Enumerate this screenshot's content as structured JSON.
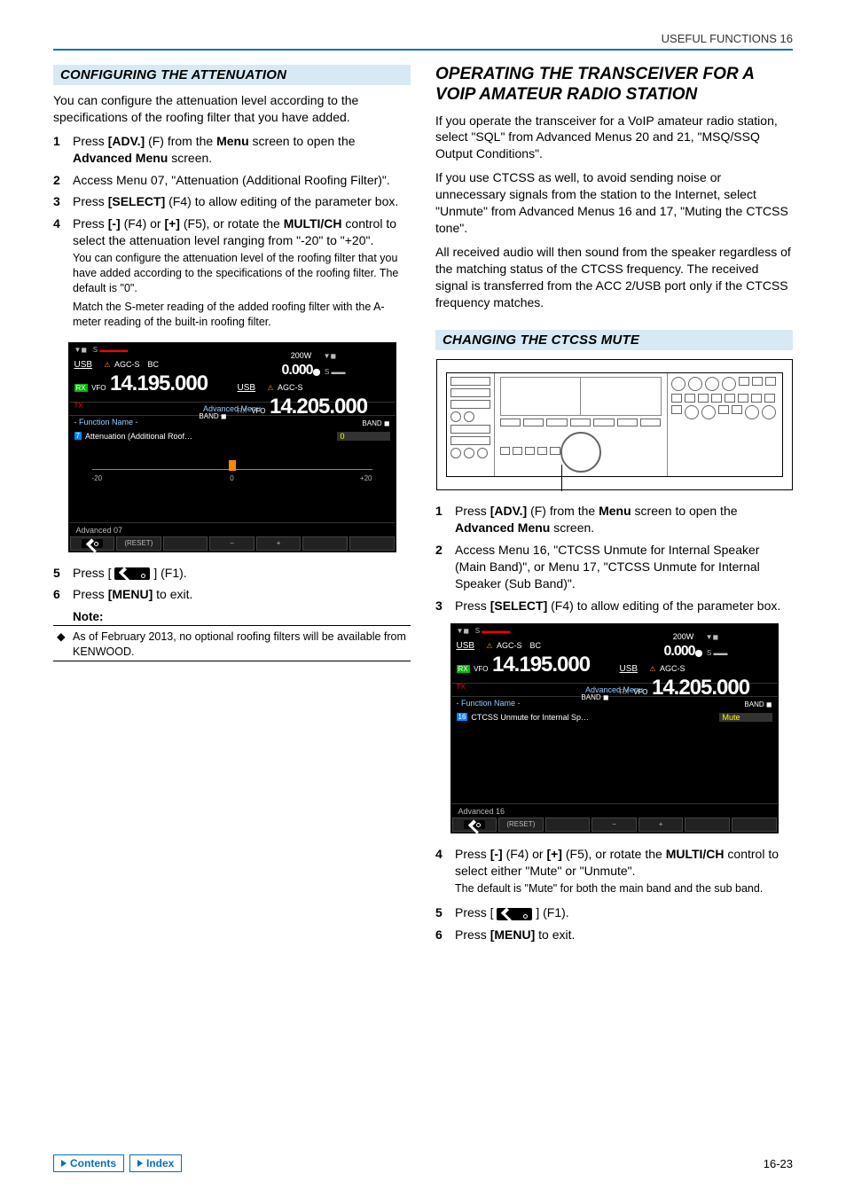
{
  "page_header": "USEFUL FUNCTIONS 16",
  "page_number": "16-23",
  "footer": {
    "contents": "Contents",
    "index": "Index"
  },
  "left": {
    "section_title": "CONFIGURING THE ATTENUATION",
    "intro": "You can configure the attenuation level according to the specifications of the roofing filter that you have added.",
    "steps": [
      {
        "n": "1",
        "t": "Press [ADV.] (F) from the Menu screen to open the Advanced Menu screen."
      },
      {
        "n": "2",
        "t": "Access Menu 07, \"Attenuation (Additional Roofing Filter)\"."
      },
      {
        "n": "3",
        "t": "Press [SELECT] (F4) to allow editing of the parameter box."
      },
      {
        "n": "4",
        "t": "Press [-] (F4) or [+] (F5), or rotate the MULTI/CH control to select the attenuation level ranging from \"-20\" to \"+20\".",
        "sub1": "You can configure the attenuation level of the roofing filter that you have added according to the specifications of the roofing filter. The default is \"0\".",
        "sub2": "Match the S-meter reading of the added roofing filter with the A-meter reading of the built-in roofing filter."
      },
      {
        "n": "5",
        "t_pre": "Press [ ",
        "t_post": " ] (F1)."
      },
      {
        "n": "6",
        "t": "Press [MENU] to exit."
      }
    ],
    "note_label": "Note:",
    "note_text": "As of February 2013, no optional roofing filters will be available from KENWOOD.",
    "screenshot": {
      "top_left": {
        "usb": "USB",
        "rx": "RX",
        "tx": "TX",
        "vfo": "VFO",
        "agc": "AGC-S",
        "bc": "BC",
        "freq": "14.195.000",
        "band": "BAND",
        "power": "200W",
        "p2": "0.000"
      },
      "top_right": {
        "usb": "USB",
        "rx": "RX",
        "tx": "TX",
        "vfo": "VFO",
        "agc": "AGC-S",
        "freq": "14.205.000",
        "band": "BAND"
      },
      "menu_header": "Advanced Menu",
      "func_name": "- Function Name -",
      "row_idx": "7",
      "row_text": "Attenuation (Additional Roof…",
      "row_val": "0",
      "slider": {
        "min": "-20",
        "mid": "0",
        "max": "+20"
      },
      "adv_label": "Advanced  07",
      "fkeys": [
        "",
        "(RESET)",
        "",
        "−",
        "+",
        "",
        ""
      ],
      "back_icon": "back-icon"
    }
  },
  "right": {
    "h1": "OPERATING THE TRANSCEIVER FOR A VOIP AMATEUR RADIO STATION",
    "p1": "If you operate the transceiver for a VoIP amateur radio station, select \"SQL\" from Advanced Menus 20 and 21, \"MSQ/SSQ Output Conditions\".",
    "p2": "If you use CTCSS as well, to avoid sending noise or unnecessary signals from the station to the Internet, select \"Unmute\" from Advanced Menus 16 and 17, \"Muting the CTCSS tone\".",
    "p3": "All received audio will then sound from the speaker regardless of the matching status of the CTCSS frequency. The received signal is transferred from the ACC 2/USB port only if the CTCSS frequency matches.",
    "section_title": "CHANGING THE CTCSS MUTE",
    "steps": [
      {
        "n": "1",
        "t": "Press [ADV.] (F) from the Menu screen to open the Advanced Menu screen."
      },
      {
        "n": "2",
        "t": "Access Menu 16, \"CTCSS Unmute for Internal Speaker (Main Band)\", or Menu 17, \"CTCSS Unmute for Internal Speaker (Sub Band)\"."
      },
      {
        "n": "3",
        "t": "Press [SELECT] (F4) to allow editing of the parameter box."
      },
      {
        "n": "4",
        "t": "Press [-] (F4) or [+] (F5), or rotate the MULTI/CH control to select either \"Mute\" or \"Unmute\".",
        "sub1": "The default is \"Mute\" for both the main band and the sub band."
      },
      {
        "n": "5",
        "t_pre": "Press [ ",
        "t_post": " ] (F1)."
      },
      {
        "n": "6",
        "t": "Press [MENU] to exit."
      }
    ],
    "screenshot": {
      "top_left": {
        "usb": "USB",
        "rx": "RX",
        "tx": "TX",
        "vfo": "VFO",
        "agc": "AGC-S",
        "bc": "BC",
        "freq": "14.195.000",
        "band": "BAND",
        "power": "200W",
        "p2": "0.000"
      },
      "top_right": {
        "usb": "USB",
        "rx": "RX",
        "tx": "TX",
        "vfo": "VFO",
        "agc": "AGC-S",
        "freq": "14.205.000",
        "band": "BAND"
      },
      "menu_header": "Advanced Menu",
      "func_name": "- Function Name -",
      "row_idx": "16",
      "row_text": "CTCSS Unmute for Internal Sp…",
      "row_val": "Mute",
      "adv_label": "Advanced  16",
      "fkeys": [
        "",
        "(RESET)",
        "",
        "−",
        "+",
        "",
        ""
      ],
      "back_icon": "back-icon"
    }
  }
}
